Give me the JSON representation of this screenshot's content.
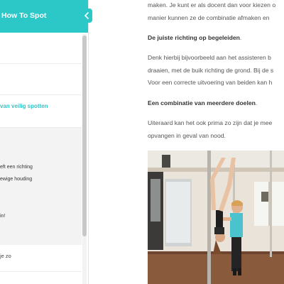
{
  "sidebar": {
    "title": "How To Spot",
    "lessons": [
      {
        "label": ""
      },
      {
        "label": ""
      },
      {
        "label": "van veilig spotten"
      }
    ],
    "sub_items": [
      "eft een richting",
      "ewige houding",
      "in!"
    ],
    "next_lesson": "je zo"
  },
  "article": {
    "line1": "maken. Je kunt er als docent dan voor kiezen o",
    "line2": "manier kunnen ze de combinatie afmaken en",
    "heading1": "De juiste richting op begeleiden",
    "heading1_suffix": ".",
    "line3": "Denk hierbij bijvoorbeeld aan het assisteren b",
    "line4": "draaien, met de buik richting de grond. Bij de s",
    "line5": "Voor een correcte uitvoering van beiden kan h",
    "heading2": "Een combinatie van meerdere doelen",
    "heading2_suffix": ".",
    "line6": "Uiteraard kan het ook prima zo zijn dat je mee",
    "line7": "opvangen in geval van nood."
  },
  "colors": {
    "accent": "#2cc7c7",
    "sidebar_panel": "#f3f3f3",
    "text": "#555555"
  },
  "icons": {
    "collapse": "chevron-left-icon"
  }
}
